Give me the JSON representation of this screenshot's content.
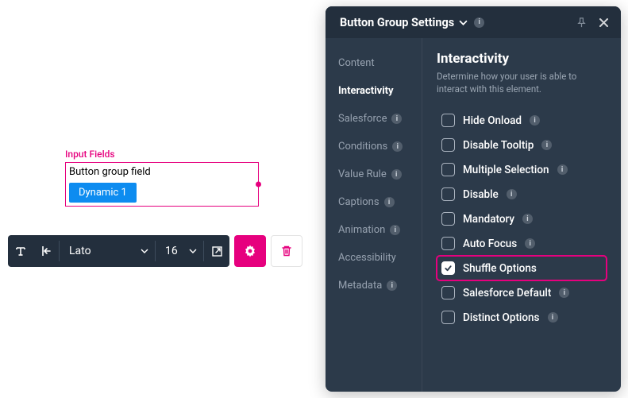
{
  "canvas": {
    "section_label": "Input Fields",
    "field_title": "Button group field",
    "chip_label": "Dynamic 1"
  },
  "toolbar": {
    "font": "Lato",
    "size": "16"
  },
  "panel": {
    "title": "Button Group Settings",
    "sidebar": [
      {
        "label": "Content",
        "info": false,
        "active": false
      },
      {
        "label": "Interactivity",
        "info": false,
        "active": true
      },
      {
        "label": "Salesforce",
        "info": true,
        "active": false
      },
      {
        "label": "Conditions",
        "info": true,
        "active": false
      },
      {
        "label": "Value Rule",
        "info": true,
        "active": false
      },
      {
        "label": "Captions",
        "info": true,
        "active": false
      },
      {
        "label": "Animation",
        "info": true,
        "active": false
      },
      {
        "label": "Accessibility",
        "info": false,
        "active": false
      },
      {
        "label": "Metadata",
        "info": true,
        "active": false
      }
    ],
    "content": {
      "heading": "Interactivity",
      "subtitle": "Determine how your user is able to interact with this element.",
      "options": [
        {
          "label": "Hide Onload",
          "info": true,
          "checked": false,
          "highlight": false
        },
        {
          "label": "Disable Tooltip",
          "info": true,
          "checked": false,
          "highlight": false
        },
        {
          "label": "Multiple Selection",
          "info": true,
          "checked": false,
          "highlight": false
        },
        {
          "label": "Disable",
          "info": true,
          "checked": false,
          "highlight": false
        },
        {
          "label": "Mandatory",
          "info": true,
          "checked": false,
          "highlight": false
        },
        {
          "label": "Auto Focus",
          "info": true,
          "checked": false,
          "highlight": false
        },
        {
          "label": "Shuffle Options",
          "info": false,
          "checked": true,
          "highlight": true
        },
        {
          "label": "Salesforce Default",
          "info": true,
          "checked": false,
          "highlight": false
        },
        {
          "label": "Distinct Options",
          "info": true,
          "checked": false,
          "highlight": false
        }
      ]
    }
  }
}
